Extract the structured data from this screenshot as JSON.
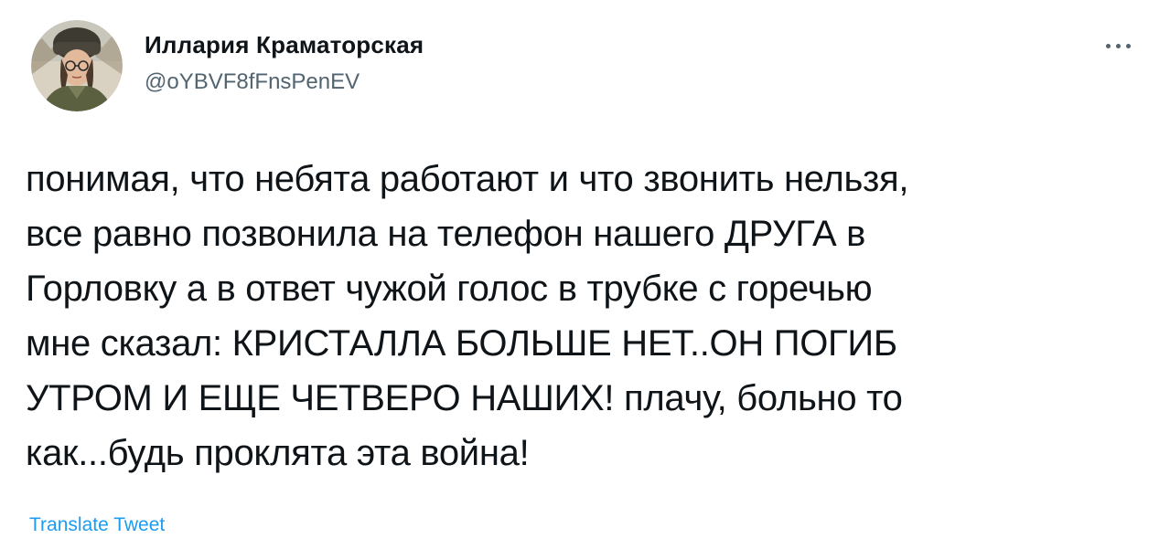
{
  "tweet": {
    "author": {
      "display_name": "Иллария Краматорская",
      "handle": "@oYBVF8fFnsPenEV",
      "avatar_icon": "user-avatar-photo"
    },
    "more_icon": "more-horizontal-icon",
    "text_lines": [
      "понимая, что небята работают и что звонить нельзя,",
      "все равно позвонила на телефон нашего ДРУГА в",
      "Горловку а в ответ чужой голос в трубке с горечью",
      "мне сказал: КРИСТАЛЛА БОЛЬШЕ НЕТ..ОН ПОГИБ",
      "УТРОМ И ЕЩЕ ЧЕТВЕРО НАШИХ! плачу, больно то",
      "как...будь проклята эта война!"
    ],
    "translate_label": "Translate Tweet",
    "colors": {
      "text": "#0f1419",
      "secondary": "#536471",
      "link": "#1d9bf0"
    }
  }
}
